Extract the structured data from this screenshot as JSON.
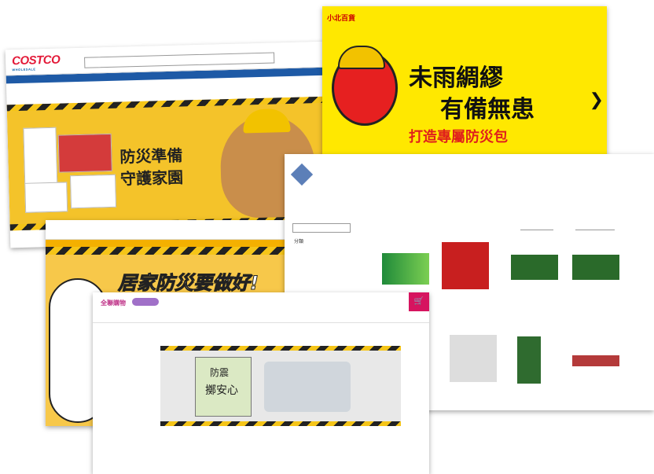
{
  "shots": {
    "costco": {
      "logo": "COSTCO",
      "logo_sub": "WHOLESALE",
      "headline_1": "防災準備",
      "headline_2": "守護家園"
    },
    "xiaobei": {
      "logo": "小北百貨",
      "line_1": "未雨綢繆",
      "line_2": "有備無患",
      "line_3": "打造專屬防災包"
    },
    "orange": {
      "title": "居家防災要做好!"
    },
    "zhenyu": {
      "section_label": "分類"
    },
    "fifth": {
      "logo": "全聯購物",
      "sign_line_1": "防震",
      "sign_line_2": "擲安心"
    }
  },
  "colors": {
    "costco_red": "#e31837",
    "costco_blue": "#1e5aa6",
    "hazard_yellow": "#f5c518",
    "xiaobei_yellow": "#ffe800",
    "accent_pink": "#d6145f"
  }
}
